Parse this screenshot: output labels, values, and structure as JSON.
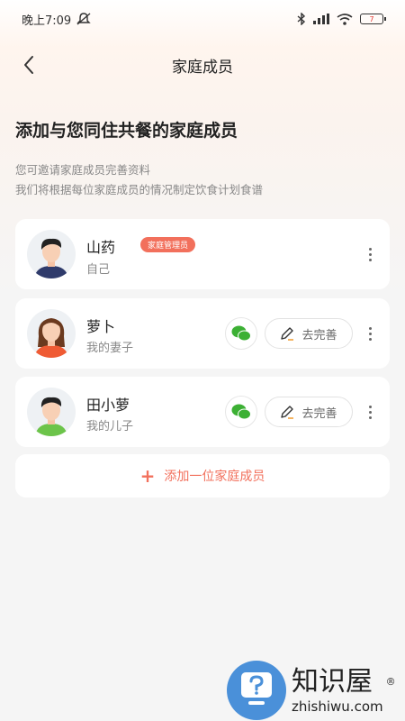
{
  "status_bar": {
    "time": "晚上7:09",
    "battery": "7"
  },
  "nav": {
    "title": "家庭成员"
  },
  "heading": "添加与您同住共餐的家庭成员",
  "description": [
    "您可邀请家庭成员完善资料",
    "我们将根据每位家庭成员的情况制定饮食计划食谱"
  ],
  "members": [
    {
      "name": "山药",
      "relation": "自己",
      "badge": "家庭管理员"
    },
    {
      "name": "萝卜",
      "relation": "我的妻子",
      "action": "去完善"
    },
    {
      "name": "田小萝",
      "relation": "我的儿子",
      "action": "去完善"
    }
  ],
  "add_member": {
    "label": "添加一位家庭成员"
  },
  "watermark": {
    "cn": "知识屋",
    "en": "zhishiwu.com",
    "reg": "®"
  },
  "colors": {
    "accent": "#f2705c",
    "wechat": "#3cb034",
    "watermark_blue": "#4a90d9"
  },
  "icons": [
    "back-arrow-icon",
    "more-vertical-icon",
    "wechat-icon",
    "edit-pencil-icon",
    "plus-icon"
  ]
}
